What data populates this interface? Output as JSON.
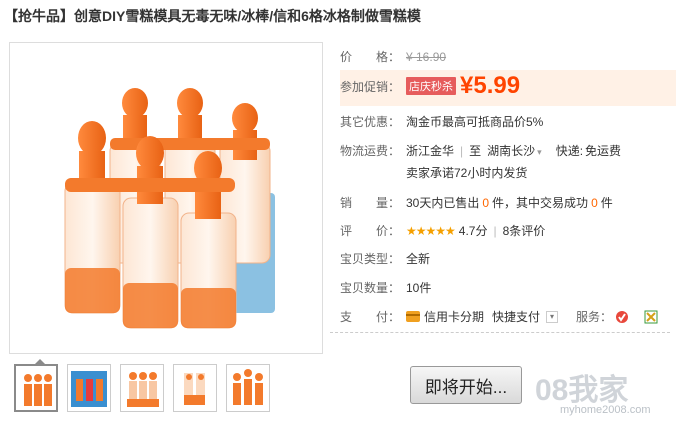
{
  "title": "【抢牛品】创意DIY雪糕模具无毒无味/冰棒/信和6格冰格制做雪糕模",
  "price": {
    "label": "价　　格：",
    "original": "¥ 16.90",
    "promo_label": "参加促销：",
    "promo_tag": "店庆秒杀",
    "current": "¥5.99"
  },
  "other_offer": {
    "label": "其它优惠：",
    "value": "淘金币最高可抵商品价5%"
  },
  "shipping": {
    "label": "物流运费：",
    "from": "浙江金华",
    "sep": "|",
    "to_prefix": "至",
    "to": "湖南长沙",
    "express_label": "快递:",
    "express_value": "免运费",
    "promise": "卖家承诺72小时内发货"
  },
  "sales": {
    "label": "销　　量：",
    "pre": "30天内已售出",
    "sold": "0",
    "mid": "件，其中交易成功",
    "success": "0",
    "post": "件"
  },
  "rating": {
    "label": "评　　价：",
    "stars": "★★★★★",
    "score": "4.7分",
    "sep": "|",
    "reviews": "8条评价"
  },
  "type": {
    "label": "宝贝类型：",
    "value": "全新"
  },
  "quantity": {
    "label": "宝贝数量：",
    "value": "10件"
  },
  "payment": {
    "label": "支　　付：",
    "card": "信用卡分期",
    "fast": "快捷支付",
    "service_label": "服务："
  },
  "action": {
    "button": "即将开始..."
  },
  "watermark": {
    "main": "08我家",
    "url": "myhome2008.com"
  },
  "colors": {
    "accent": "#ff4400",
    "product": "#f37a2c",
    "link": "#ff6600"
  },
  "thumbnails": [
    {
      "name": "thumb-1"
    },
    {
      "name": "thumb-2"
    },
    {
      "name": "thumb-3"
    },
    {
      "name": "thumb-4"
    },
    {
      "name": "thumb-5"
    }
  ]
}
